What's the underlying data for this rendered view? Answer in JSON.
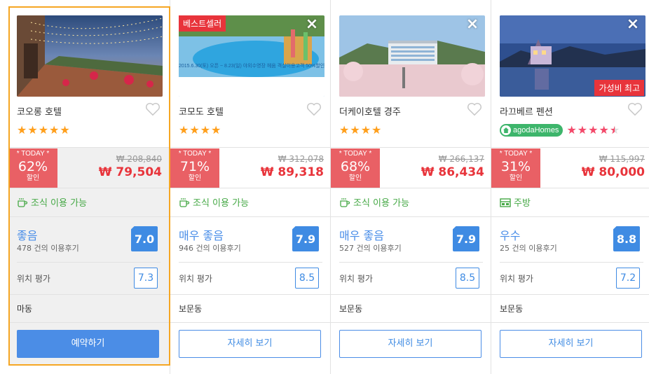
{
  "cards": [
    {
      "name": "코오롱 호텔",
      "stars": 5,
      "star_color": "#ff9f1c",
      "today_label": "* TODAY *",
      "discount": "62%",
      "discount_label": "할인",
      "original_price": "₩ 208,840",
      "sale_price": "₩ 79,504",
      "amenity": "조식 이용 가능",
      "amenity_icon": "coffee-cup-icon",
      "score_label": "좋음",
      "reviews": "478 건의 이용후기",
      "score": "7.0",
      "location_label": "위치 평가",
      "location_score": "7.3",
      "area": "마동",
      "button": "예약하기"
    },
    {
      "name": "코모도 호텔",
      "badge": "베스트셀러",
      "stars": 4,
      "star_color": "#ff9f1c",
      "today_label": "* TODAY *",
      "discount": "71%",
      "discount_label": "할인",
      "original_price": "₩ 312,078",
      "sale_price": "₩ 89,318",
      "amenity": "조식 이용 가능",
      "amenity_icon": "coffee-cup-icon",
      "score_label": "매우 좋음",
      "reviews": "946 건의 이용후기",
      "score": "7.9",
      "location_label": "위치 평가",
      "location_score": "8.5",
      "area": "보문동",
      "button": "자세히 보기",
      "photo_text": "2015.6.30(토) 오픈 ~ 8.23(일) 야외수영장 헤움 객실이용고객 50%할인"
    },
    {
      "name": "더케이호텔 경주",
      "stars": 4,
      "star_color": "#ff9f1c",
      "today_label": "* TODAY *",
      "discount": "68%",
      "discount_label": "할인",
      "original_price": "₩ 266,137",
      "sale_price": "₩ 86,434",
      "amenity": "조식 이용 가능",
      "amenity_icon": "coffee-cup-icon",
      "score_label": "매우 좋음",
      "reviews": "527 건의 이용후기",
      "score": "7.9",
      "location_label": "위치 평가",
      "location_score": "8.5",
      "area": "보문동",
      "button": "자세히 보기"
    },
    {
      "name": "라끄베르 펜션",
      "badge": "가성비 최고",
      "agoda": "agodaHomes",
      "stars": 4.5,
      "star_color": "#f3496a",
      "today_label": "* TODAY *",
      "discount": "31%",
      "discount_label": "할인",
      "original_price": "₩ 115,997",
      "sale_price": "₩ 80,000",
      "amenity": "주방",
      "amenity_icon": "kitchen-icon",
      "score_label": "우수",
      "reviews": "25 건의 이용후기",
      "score": "8.8",
      "location_label": "위치 평가",
      "location_score": "7.2",
      "area": "보문동",
      "button": "자세히 보기"
    }
  ]
}
